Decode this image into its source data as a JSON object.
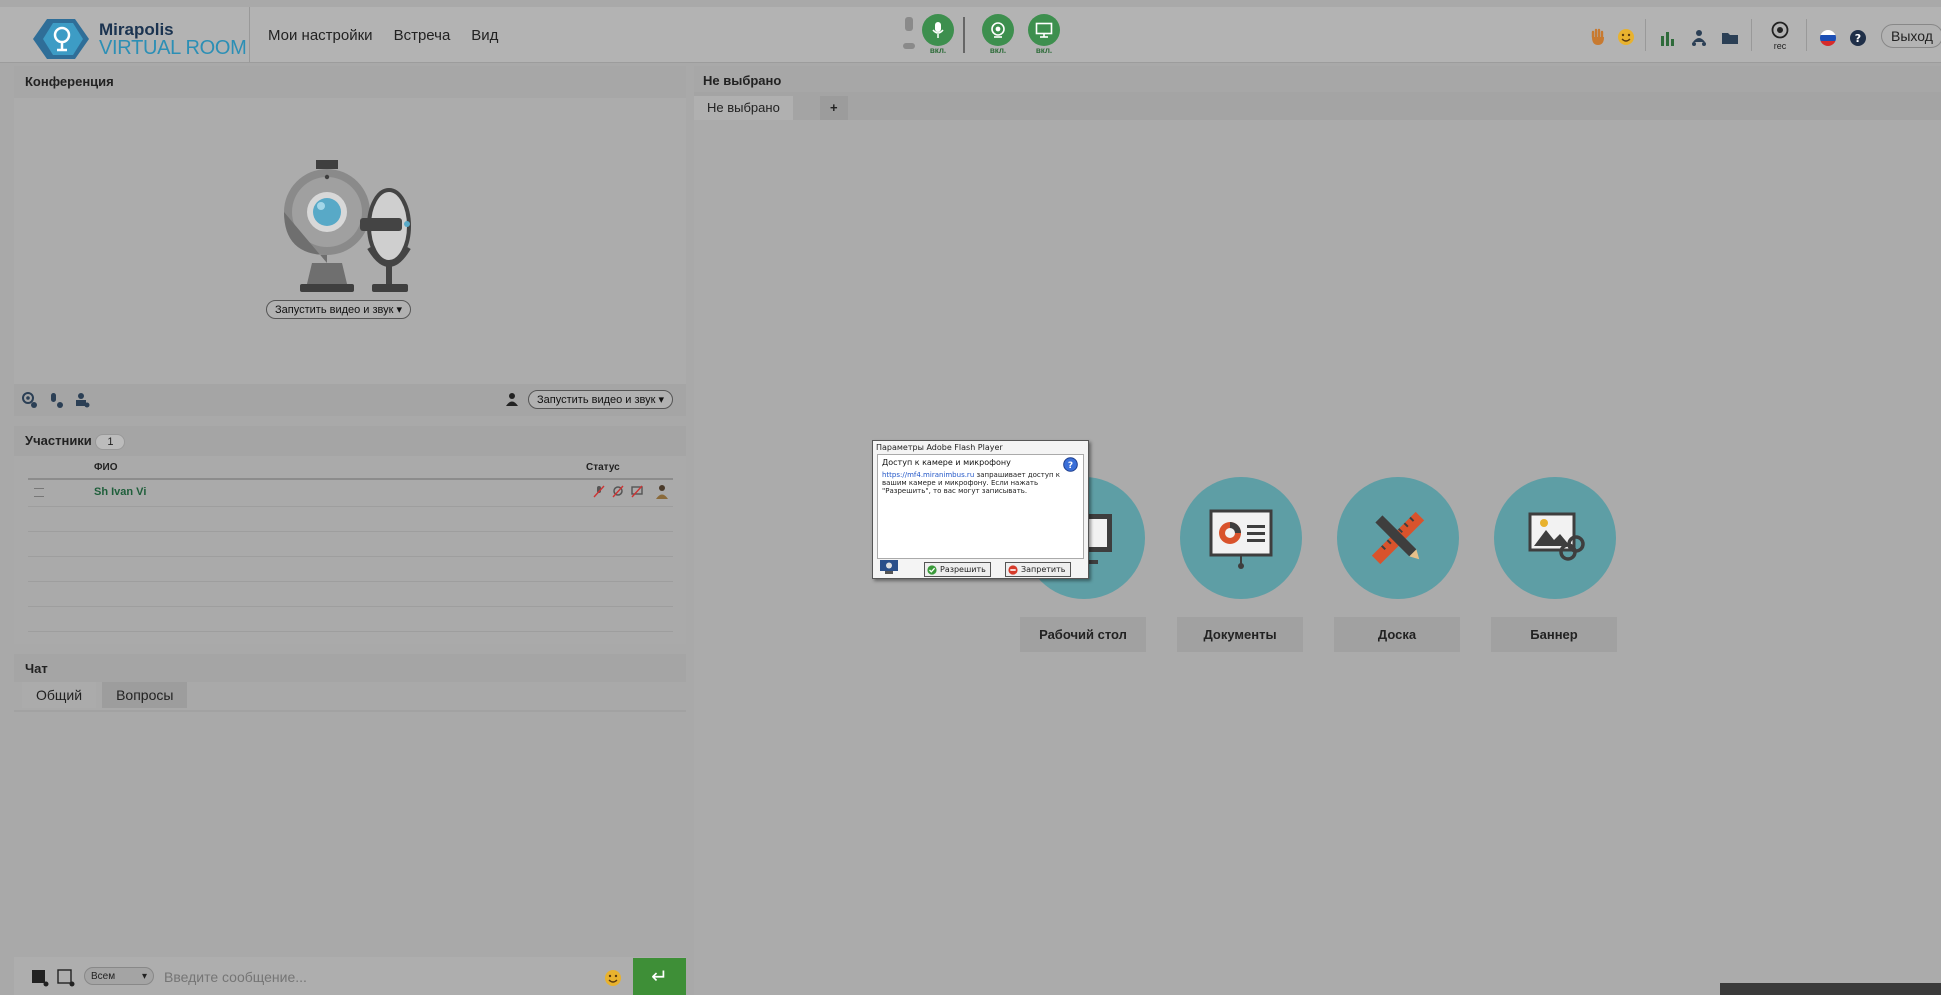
{
  "app": {
    "logo_line1": "Mirapolis",
    "logo_line2": "VIRTUAL ROOM"
  },
  "menu": {
    "items": [
      "Мои настройки",
      "Встреча",
      "Вид"
    ]
  },
  "media": {
    "mic_label": "вкл.",
    "camera_label": "вкл.",
    "screen_label": "вкл."
  },
  "toolbar_right": {
    "rec_label": "rec",
    "exit_label": "Выход"
  },
  "conference": {
    "title": "Конференция",
    "start_video_label": "Запустить видео и звук",
    "start_video_label_bottom": "Запустить видео и звук"
  },
  "participants": {
    "title": "Участники",
    "count": "1",
    "col_name": "ФИО",
    "col_status": "Статус",
    "rows": [
      {
        "name": "Sh Ivan Vi"
      }
    ]
  },
  "chat": {
    "title": "Чат",
    "tabs": [
      "Общий",
      "Вопросы"
    ],
    "recipient": "Всем",
    "input_placeholder": "Введите сообщение..."
  },
  "main": {
    "header": "Не выбрано",
    "tabs": [
      "Не выбрано",
      "+"
    ],
    "tools": [
      "Рабочий стол",
      "Документы",
      "Доска",
      "Баннер"
    ]
  },
  "flash_dialog": {
    "title": "Параметры Adobe Flash Player",
    "heading": "Доступ к камере и микрофону",
    "link": "https://mf4.miranimbus.ru",
    "text": "запрашивает доступ к вашим камере и микрофону. Если нажать \"Разрешить\", то вас могут записывать.",
    "allow_label": "Разрешить",
    "deny_label": "Запретить"
  },
  "colors": {
    "accent_green": "#3d8f4e",
    "tool_circle": "#5e9ea5",
    "logo_blue": "#2c8fb5"
  }
}
